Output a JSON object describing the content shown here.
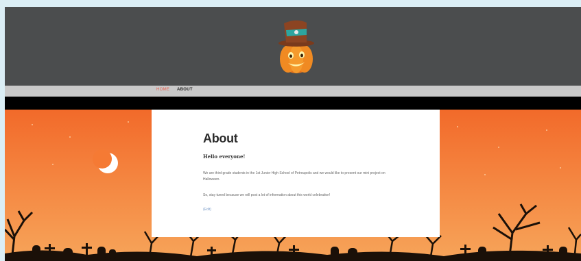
{
  "nav": {
    "home_label": "HOME",
    "about_label": "ABOUT"
  },
  "colors": {
    "header": "#4b4d4e",
    "nav_bar": "#c9c9c9",
    "nav_active": "#e85c4a",
    "sky_top": "#f26a2a",
    "sky_bottom": "#f7a55a",
    "silhouette": "#1a1008"
  },
  "content": {
    "title": "About",
    "greeting": "Hello everyone!",
    "paragraph1": "We are third grade students in the 1st Junior High School of Petroupolis and we would like to present our mini project on Halloween.",
    "paragraph2": "So, stay tuned because we will post a lot of information about this world celebration!",
    "link_text": "(Edit)"
  },
  "icons": {
    "logo": "pumpkin-with-hat-icon",
    "moon": "crescent-moon-icon"
  }
}
